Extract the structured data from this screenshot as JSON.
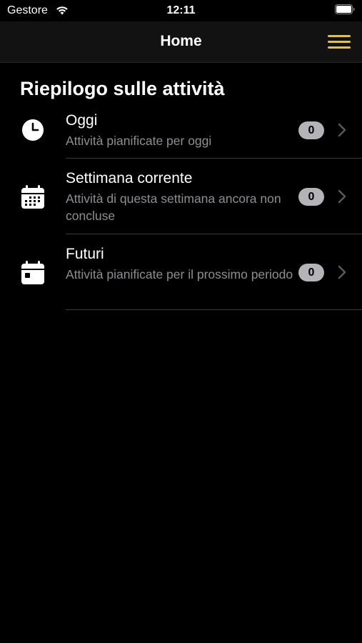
{
  "status_bar": {
    "carrier": "Gestore",
    "time": "12:11",
    "wifi_icon": "wifi-icon",
    "battery_icon": "battery-icon"
  },
  "navbar": {
    "title": "Home",
    "menu_icon": "hamburger-menu-icon",
    "accent_color": "#f2c21b"
  },
  "section": {
    "title": "Riepilogo sulle attività"
  },
  "rows": [
    {
      "title": "Oggi",
      "subtitle": "Attività pianificate per oggi",
      "count": "0",
      "icon": "clock-icon"
    },
    {
      "title": "Settimana corrente",
      "subtitle": "Attività di questa settimana ancora non concluse",
      "count": "0",
      "icon": "calendar-week-icon"
    },
    {
      "title": "Futuri",
      "subtitle": "Attività pianificate per il prossimo periodo",
      "count": "0",
      "icon": "calendar-day-icon"
    }
  ]
}
